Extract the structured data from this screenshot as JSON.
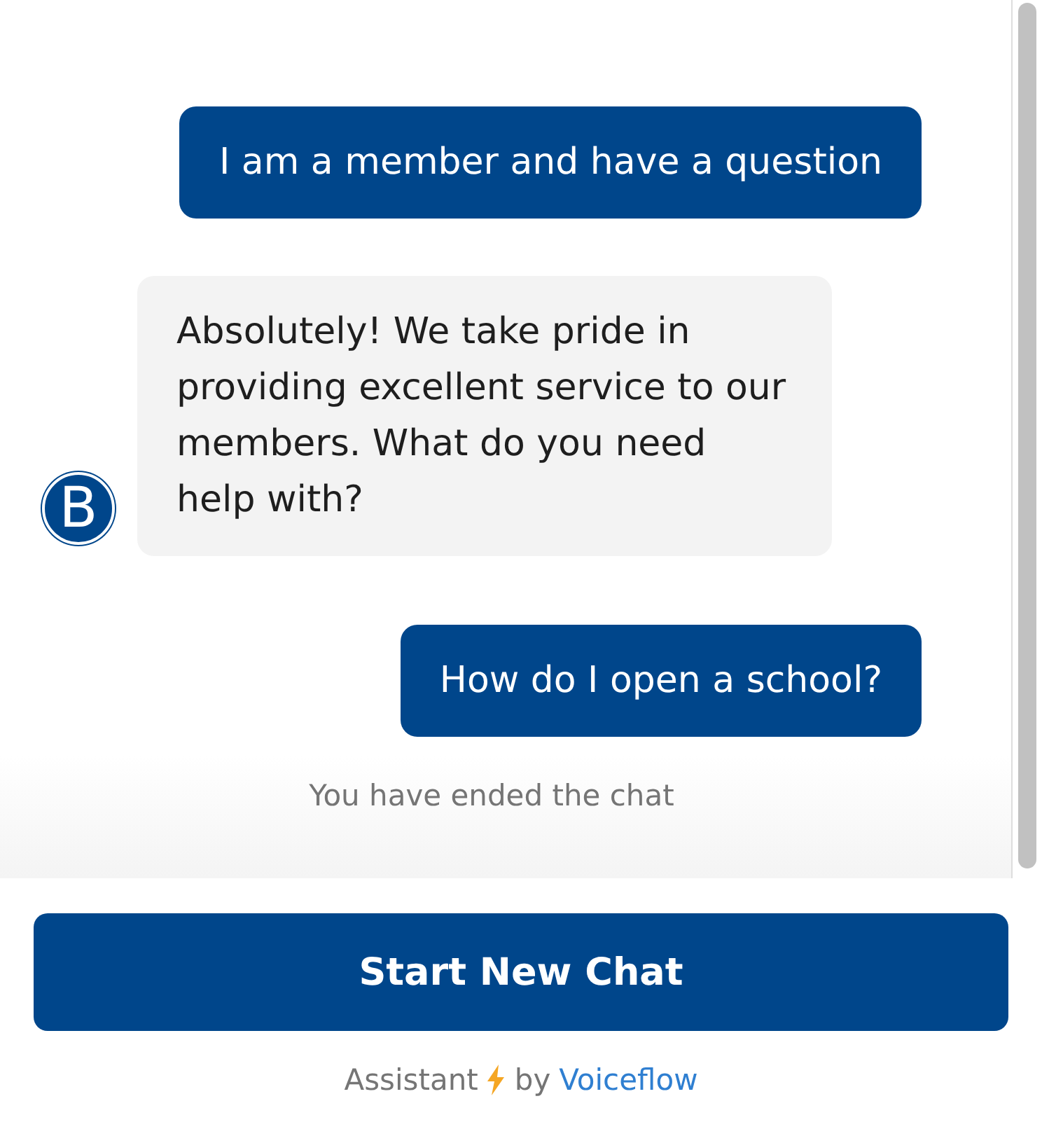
{
  "messages": [
    {
      "kind": "user",
      "text": "I am a member and have a question"
    },
    {
      "kind": "bot",
      "text": "Absolutely! We take pride in providing excellent service to our members. What do you need help with?",
      "avatar": "B"
    },
    {
      "kind": "user",
      "text": "How do I open a school?"
    }
  ],
  "status": "You have ended the chat",
  "button": "Start New Chat",
  "footer": {
    "label": "Assistant",
    "by": "by",
    "link": "Voiceflow"
  }
}
